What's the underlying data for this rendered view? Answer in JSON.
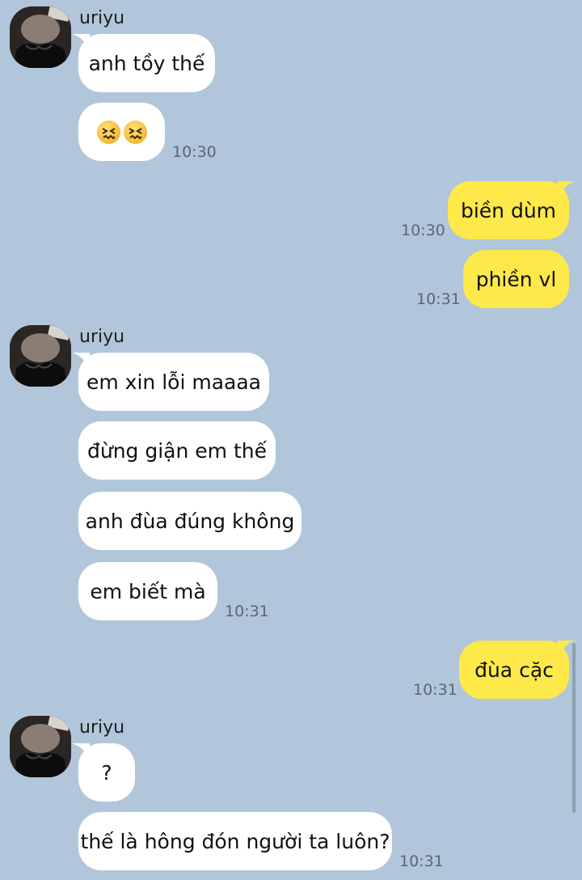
{
  "colors": {
    "background": "#b1c6da",
    "incoming_bubble": "#ffffff",
    "outgoing_bubble": "#fee94a",
    "timestamp": "#5e6670"
  },
  "groups": [
    {
      "sender": "uriyu",
      "avatar_icon": "profile-photo",
      "messages": [
        {
          "text": "anh tồy thế"
        },
        {
          "text": "😖😖",
          "time": "10:30"
        }
      ]
    },
    {
      "sender": "me",
      "messages": [
        {
          "text": "biền dùm",
          "time": "10:30"
        },
        {
          "text": "phiền vl",
          "time": "10:31"
        }
      ]
    },
    {
      "sender": "uriyu",
      "avatar_icon": "profile-photo",
      "messages": [
        {
          "text": "em xin lỗi maaaa"
        },
        {
          "text": "đừng giận em thế"
        },
        {
          "text": "anh đùa đúng không"
        },
        {
          "text": "em biết mà",
          "time": "10:31"
        }
      ]
    },
    {
      "sender": "me",
      "messages": [
        {
          "text": "đùa cặc",
          "time": "10:31"
        }
      ]
    },
    {
      "sender": "uriyu",
      "avatar_icon": "profile-photo",
      "messages": [
        {
          "text": "?"
        },
        {
          "text": "thế là hông đón người ta luôn?",
          "time": "10:31"
        }
      ]
    }
  ]
}
